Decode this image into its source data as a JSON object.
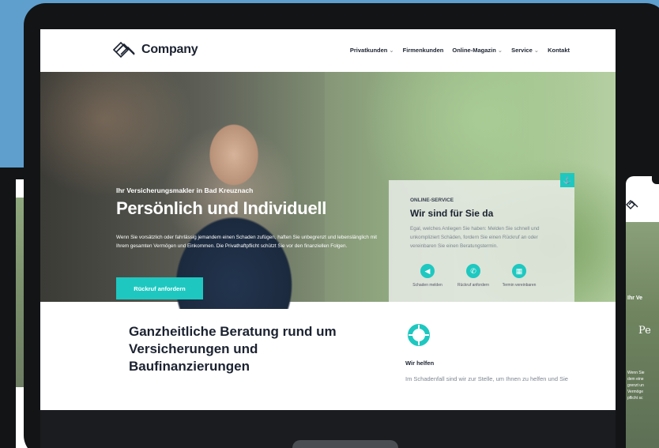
{
  "site": {
    "logo_text": "Company",
    "nav": [
      {
        "label": "Privatkunden",
        "has_dropdown": true
      },
      {
        "label": "Firmenkunden",
        "has_dropdown": false
      },
      {
        "label": "Online-Magazin",
        "has_dropdown": true
      },
      {
        "label": "Service",
        "has_dropdown": true
      },
      {
        "label": "Kontakt",
        "has_dropdown": false
      }
    ],
    "dropdown_glyph": "⌄"
  },
  "hero": {
    "eyebrow": "Ihr Versicherungsmakler in Bad Kreuznach",
    "title": "Persönlich und Individuell",
    "text": "Wenn Sie vorsätzlich oder fahrlässig jemandem einen Schaden zufügen, haften Sie unbegrenzt und lebenslänglich mit Ihrem gesamten Vermögen und Einkommen. Die Privathaftpflicht schützt Sie vor den finanziellen Folgen.",
    "cta": "Rückruf anfordern"
  },
  "service_card": {
    "eyebrow": "ONLINE-SERVICE",
    "title": "Wir sind für Sie da",
    "text": "Egal, welches Anliegen Sie haben: Melden Sie schnell und unkompliziert Schäden, fordern Sie einen Rückruf an oder vereinbaren Sie einen Beratungstermin.",
    "actions": [
      {
        "label": "Schaden melden",
        "icon": "megaphone-icon",
        "glyph": "◀"
      },
      {
        "label": "Rückruf anfordern",
        "icon": "phone-icon",
        "glyph": "✆"
      },
      {
        "label": "Termin vereinbaren",
        "icon": "calendar-icon",
        "glyph": "▦"
      }
    ],
    "badge_glyph": "⚓"
  },
  "content": {
    "title": "Ganzheitliche Beratung rund um Versicherungen und Baufinanzierungen",
    "label": "Wir helfen",
    "text": "Im Schadenfall sind wir zur Stelle, um Ihnen zu helfen und Sie"
  },
  "phone_left": {
    "menu_glyph": "≡"
  },
  "phone_right": {
    "eyebrow": "Ihr Ve",
    "title": "Pe",
    "text_lines": [
      "Wenn Sie",
      "dem eine",
      "grenzt un",
      "Vermöge",
      "pflicht sc"
    ]
  },
  "colors": {
    "accent": "#1ec8c0",
    "background": "#5e9fce",
    "dark": "#1b2230"
  }
}
